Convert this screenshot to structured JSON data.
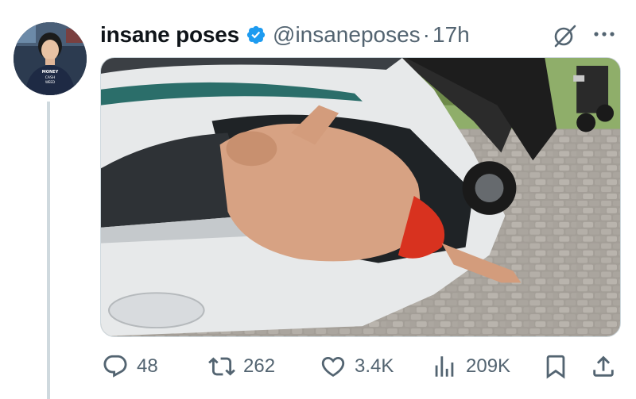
{
  "tweet": {
    "display_name": "insane poses",
    "handle": "@insaneposes",
    "separator": "·",
    "time": "17h",
    "avatar_text": [
      "MONEY",
      "CASH",
      "WEED"
    ],
    "media_alt": "Large man squeezing out of a sports car's open butterfly door"
  },
  "actions": {
    "replies": "48",
    "reposts": "262",
    "likes": "3.4K",
    "views": "209K"
  },
  "colors": {
    "verified_blue": "#1d9bf0",
    "icon_gray": "#536471",
    "thread_line": "#cfd9de"
  },
  "icons": [
    "verified-badge-icon",
    "grok-icon",
    "more-icon",
    "reply-icon",
    "repost-icon",
    "like-icon",
    "views-icon",
    "bookmark-icon",
    "share-icon"
  ]
}
